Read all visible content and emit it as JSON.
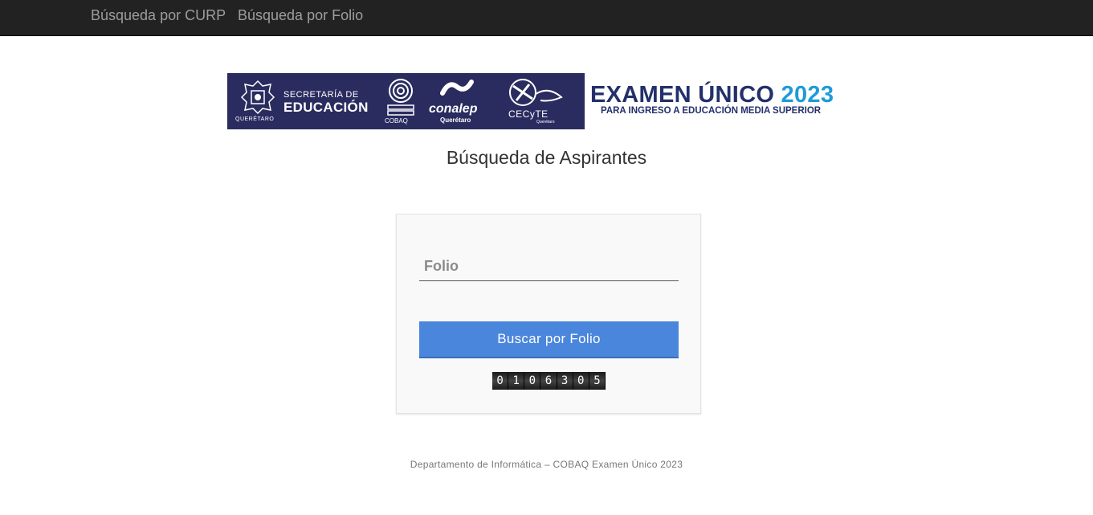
{
  "nav": {
    "items": [
      {
        "label": "Búsqueda por CURP"
      },
      {
        "label": "Búsqueda por Folio"
      }
    ]
  },
  "banner": {
    "secretaria_small": "SECRETARÍA DE",
    "secretaria_big": "EDUCACIÓN",
    "queretaro": "QUERÉTARO",
    "cobaq": "COBAQ",
    "conalep": "conalep",
    "conalep_sub": "Querétaro",
    "cecyte": "CECyTE",
    "cecyte_sub": "Querétaro",
    "exam_title": "EXAMEN ÚNICO",
    "exam_year": "2023",
    "exam_subtitle": "PARA INGRESO A EDUCACIÓN MEDIA SUPERIOR",
    "colors": {
      "navy": "#2a2c60",
      "title": "#23306b",
      "accent": "#1f9bd7"
    }
  },
  "main": {
    "title": "Búsqueda de Aspirantes",
    "folio_placeholder": "Folio",
    "folio_value": "",
    "search_button": "Buscar por Folio",
    "visit_counter": [
      "0",
      "1",
      "0",
      "6",
      "3",
      "0",
      "5"
    ]
  },
  "footer": {
    "text": "Departamento de Informática – COBAQ Examen Único 2023"
  },
  "colors": {
    "navbar_bg": "#222222",
    "nav_link": "#9d9d9d",
    "button_bg": "#4a86dc"
  }
}
